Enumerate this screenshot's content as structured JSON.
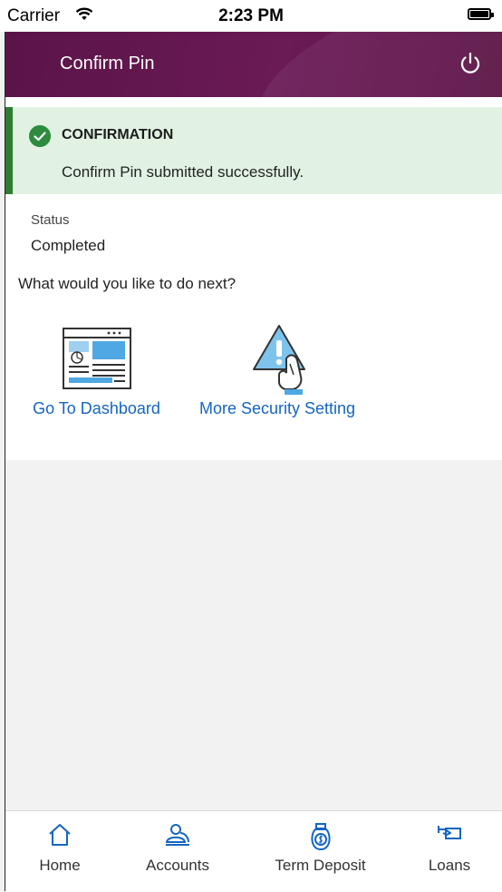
{
  "statusbar": {
    "carrier": "Carrier",
    "time": "2:23 PM"
  },
  "header": {
    "title": "Confirm Pin",
    "power_icon": "power-icon",
    "gradient": [
      "#5a1448",
      "#6a1a55"
    ]
  },
  "confirmation": {
    "heading": "CONFIRMATION",
    "message": "Confirm Pin submitted successfully.",
    "color": "#2e7d32",
    "background": "#e1f2e3"
  },
  "status": {
    "label": "Status",
    "value": "Completed"
  },
  "next_prompt": "What would you like to do next?",
  "actions": [
    {
      "label": "Go To Dashboard",
      "icon": "dashboard-icon"
    },
    {
      "label": "More Security Setting",
      "icon": "security-warning-icon"
    }
  ],
  "tabs": [
    {
      "label": "Home",
      "icon": "home-icon"
    },
    {
      "label": "Accounts",
      "icon": "accounts-icon"
    },
    {
      "label": "Term Deposit",
      "icon": "money-bag-icon"
    },
    {
      "label": "Loans",
      "icon": "loan-hand-icon"
    }
  ],
  "link_color": "#1565c0"
}
